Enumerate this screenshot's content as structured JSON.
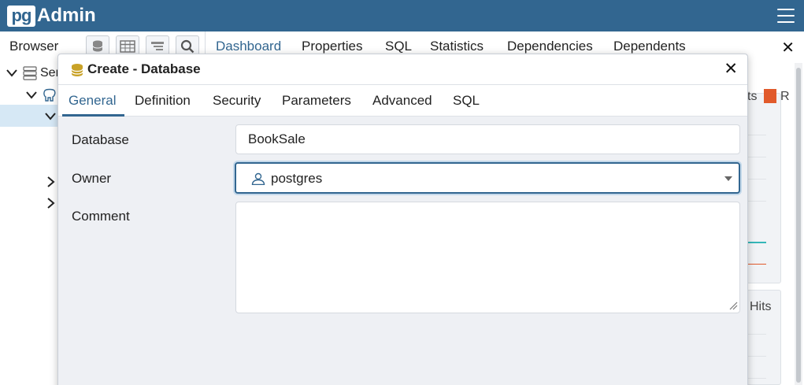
{
  "app": {
    "logo_pg": "pg",
    "logo_admin": "Admin"
  },
  "browser": {
    "title": "Browser",
    "toolbar_icons": [
      "database-icon",
      "table-icon",
      "filter-icon",
      "search-icon"
    ]
  },
  "main_tabs": [
    {
      "label": "Dashboard",
      "active": true
    },
    {
      "label": "Properties",
      "active": false
    },
    {
      "label": "SQL",
      "active": false
    },
    {
      "label": "Statistics",
      "active": false
    },
    {
      "label": "Dependencies",
      "active": false
    },
    {
      "label": "Dependents",
      "active": false
    }
  ],
  "tree": {
    "servers_label": "Ser"
  },
  "background_panels": {
    "legend_partial": "ts",
    "legend_letter": "R",
    "hits_label": "Hits",
    "legend_color": "#e15a2b"
  },
  "dialog": {
    "title": "Create - Database",
    "tabs": [
      {
        "label": "General",
        "active": true
      },
      {
        "label": "Definition",
        "active": false
      },
      {
        "label": "Security",
        "active": false
      },
      {
        "label": "Parameters",
        "active": false
      },
      {
        "label": "Advanced",
        "active": false
      },
      {
        "label": "SQL",
        "active": false
      }
    ],
    "fields": {
      "database": {
        "label": "Database",
        "value": "BookSale"
      },
      "owner": {
        "label": "Owner",
        "value": "postgres"
      },
      "comment": {
        "label": "Comment",
        "value": ""
      }
    }
  },
  "colors": {
    "brand": "#326690",
    "db_icon": "#c9a227"
  }
}
